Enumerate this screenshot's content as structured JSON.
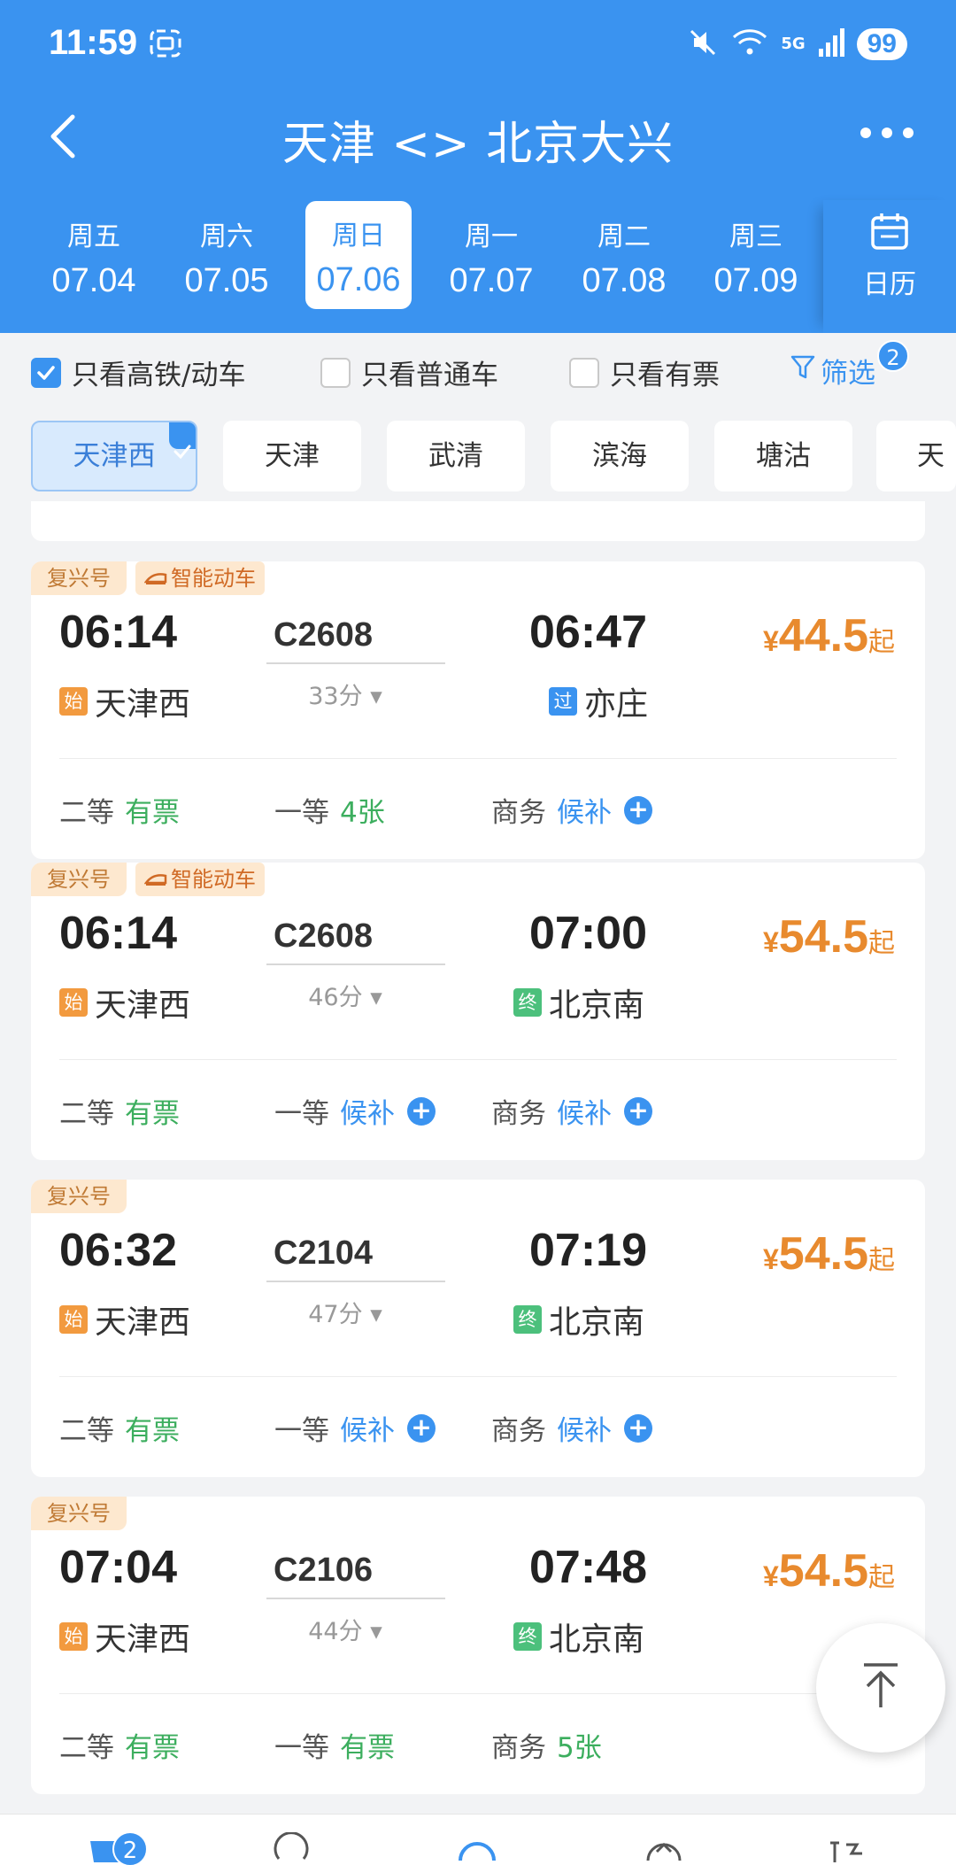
{
  "status_bar": {
    "time": "11:59",
    "network": "5G",
    "battery": "99"
  },
  "nav": {
    "title": "天津 <> 北京大兴"
  },
  "dates": [
    {
      "weekday": "周五",
      "date": "07.04",
      "selected": false
    },
    {
      "weekday": "周六",
      "date": "07.05",
      "selected": false
    },
    {
      "weekday": "周日",
      "date": "07.06",
      "selected": true
    },
    {
      "weekday": "周一",
      "date": "07.07",
      "selected": false
    },
    {
      "weekday": "周二",
      "date": "07.08",
      "selected": false
    },
    {
      "weekday": "周三",
      "date": "07.09",
      "selected": false
    }
  ],
  "calendar_label": "日历",
  "filters": {
    "high_speed_only": {
      "label": "只看高铁/动车",
      "checked": true
    },
    "normal_only": {
      "label": "只看普通车",
      "checked": false
    },
    "available_only": {
      "label": "只看有票",
      "checked": false
    },
    "screen_label": "筛选",
    "screen_count": "2"
  },
  "stations": [
    {
      "name": "天津西",
      "selected": true
    },
    {
      "name": "天津",
      "selected": false
    },
    {
      "name": "武清",
      "selected": false
    },
    {
      "name": "滨海",
      "selected": false
    },
    {
      "name": "塘沽",
      "selected": false
    },
    {
      "name": "天",
      "selected": false
    }
  ],
  "trains": [
    {
      "tag": "复兴号",
      "smart_tag": "智能动车",
      "depart_time": "06:14",
      "train_no": "C2608",
      "arrive_time": "06:47",
      "duration": "33分",
      "price_symbol": "¥",
      "price": "44.5",
      "price_suffix": "起",
      "from_badge": "始",
      "from_station": "天津西",
      "to_badge": "过",
      "to_station": "亦庄",
      "seats": {
        "second_label": "二等",
        "second_status": "有票",
        "first_label": "一等",
        "first_status": "4张",
        "business_label": "商务",
        "business_status": "候补"
      }
    },
    {
      "tag": "复兴号",
      "smart_tag": "智能动车",
      "depart_time": "06:14",
      "train_no": "C2608",
      "arrive_time": "07:00",
      "duration": "46分",
      "price_symbol": "¥",
      "price": "54.5",
      "price_suffix": "起",
      "from_badge": "始",
      "from_station": "天津西",
      "to_badge": "终",
      "to_station": "北京南",
      "seats": {
        "second_label": "二等",
        "second_status": "有票",
        "first_label": "一等",
        "first_status": "候补",
        "business_label": "商务",
        "business_status": "候补"
      }
    },
    {
      "tag": "复兴号",
      "smart_tag": "",
      "depart_time": "06:32",
      "train_no": "C2104",
      "arrive_time": "07:19",
      "duration": "47分",
      "price_symbol": "¥",
      "price": "54.5",
      "price_suffix": "起",
      "from_badge": "始",
      "from_station": "天津西",
      "to_badge": "终",
      "to_station": "北京南",
      "seats": {
        "second_label": "二等",
        "second_status": "有票",
        "first_label": "一等",
        "first_status": "候补",
        "business_label": "商务",
        "business_status": "候补"
      }
    },
    {
      "tag": "复兴号",
      "smart_tag": "",
      "depart_time": "07:04",
      "train_no": "C2106",
      "arrive_time": "07:48",
      "duration": "44分",
      "price_symbol": "¥",
      "price": "54.5",
      "price_suffix": "起",
      "from_badge": "始",
      "from_station": "天津西",
      "to_badge": "终",
      "to_station": "北京南",
      "seats": {
        "second_label": "二等",
        "second_status": "有票",
        "first_label": "一等",
        "first_status": "有票",
        "business_label": "商务",
        "business_status": "5张"
      }
    }
  ],
  "bottom_tab": {
    "badge": "2"
  },
  "colors": {
    "primary": "#3a93f0",
    "price": "#e88a2e",
    "available": "#3cae5e"
  }
}
